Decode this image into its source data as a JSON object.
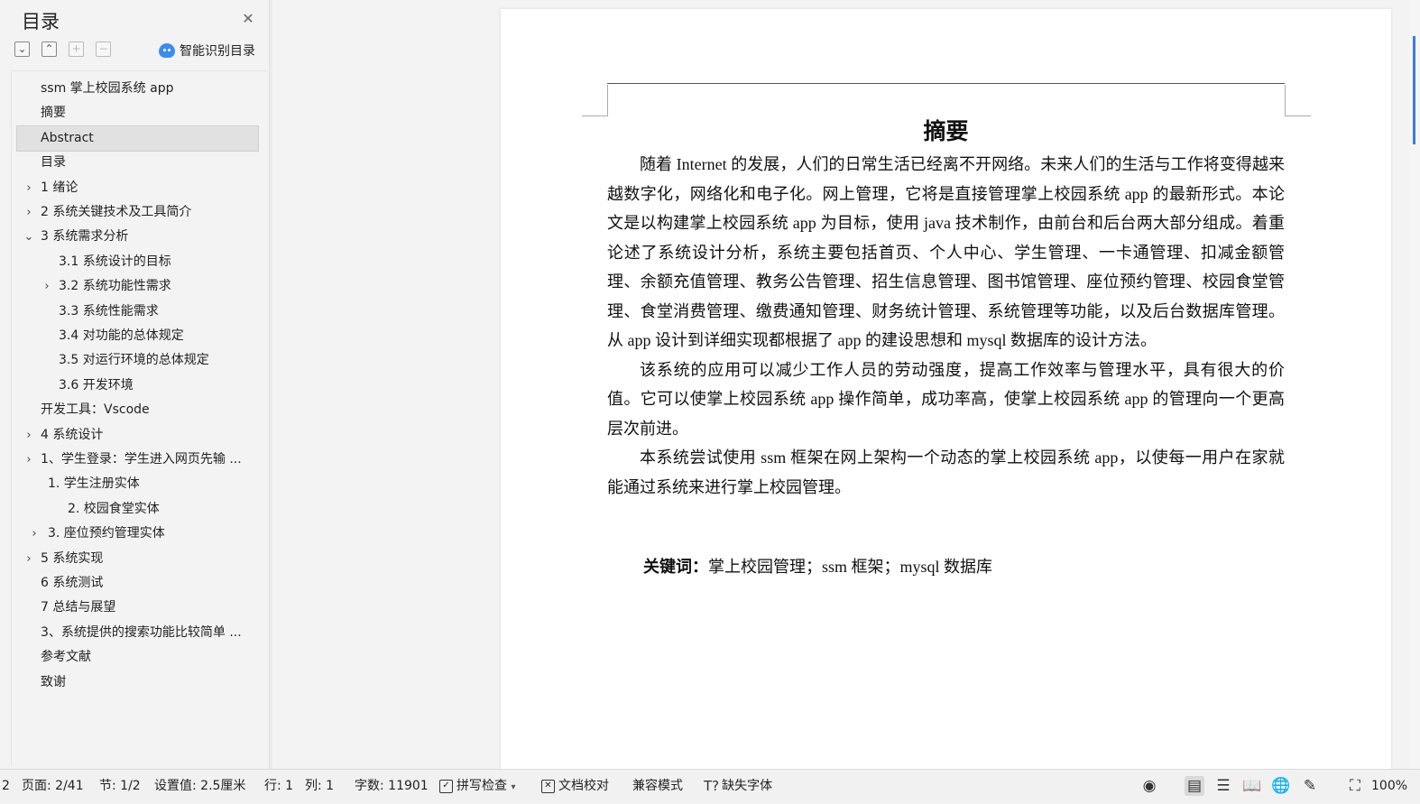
{
  "toc": {
    "title": "目录",
    "smart_button": "智能识别目录",
    "items": [
      {
        "label": "ssm 掌上校园系统 app",
        "arrow": ""
      },
      {
        "label": "摘要",
        "arrow": ""
      },
      {
        "label": "Abstract",
        "arrow": ""
      },
      {
        "label": "目录",
        "arrow": ""
      },
      {
        "label": "1 绪论",
        "arrow": "›"
      },
      {
        "label": "2 系统关键技术及工具简介",
        "arrow": "›"
      },
      {
        "label": "3 系统需求分析",
        "arrow": "⌄"
      },
      {
        "label": "3.1 系统设计的目标",
        "arrow": ""
      },
      {
        "label": "3.2 系统功能性需求",
        "arrow": "›"
      },
      {
        "label": "3.3 系统性能需求",
        "arrow": ""
      },
      {
        "label": "3.4 对功能的总体规定",
        "arrow": ""
      },
      {
        "label": "3.5 对运行环境的总体规定",
        "arrow": ""
      },
      {
        "label": "3.6 开发环境",
        "arrow": ""
      },
      {
        "label": "开发工具：Vscode",
        "arrow": ""
      },
      {
        "label": "4 系统设计",
        "arrow": "›"
      },
      {
        "label": "1、学生登录：学生进入网页先输 ...",
        "arrow": "›"
      },
      {
        "label": "1. 学生注册实体",
        "arrow": ""
      },
      {
        "label": "2. 校园食堂实体",
        "arrow": ""
      },
      {
        "label": "3. 座位预约管理实体",
        "arrow": "›"
      },
      {
        "label": "5 系统实现",
        "arrow": "›"
      },
      {
        "label": "6 系统测试",
        "arrow": ""
      },
      {
        "label": "7 总结与展望",
        "arrow": ""
      },
      {
        "label": "3、系统提供的搜索功能比较简单 ...",
        "arrow": ""
      },
      {
        "label": "参考文献",
        "arrow": ""
      },
      {
        "label": "致谢",
        "arrow": ""
      }
    ]
  },
  "document": {
    "title": "摘要",
    "paragraphs": [
      "随着 Internet 的发展，人们的日常生活已经离不开网络。未来人们的生活与工作将变得越来越数字化，网络化和电子化。网上管理，它将是直接管理掌上校园系统 app 的最新形式。本论文是以构建掌上校园系统 app 为目标，使用 java 技术制作，由前台和后台两大部分组成。着重论述了系统设计分析，系统主要包括首页、个人中心、学生管理、一卡通管理、扣减金额管理、余额充值管理、教务公告管理、招生信息管理、图书馆管理、座位预约管理、校园食堂管理、食堂消费管理、缴费通知管理、财务统计管理、系统管理等功能，以及后台数据库管理。从 app 设计到详细实现都根据了 app 的建设思想和 mysql 数据库的设计方法。",
      "该系统的应用可以减少工作人员的劳动强度，提高工作效率与管理水平，具有很大的价值。它可以使掌上校园系统 app 操作简单，成功率高，使掌上校园系统 app 的管理向一个更高层次前进。",
      "本系统尝试使用 ssm 框架在网上架构一个动态的掌上校园系统 app，以使每一用户在家就能通过系统来进行掌上校园管理。"
    ],
    "keywords_label": "关键词：",
    "keywords": "掌上校园管理；ssm 框架；mysql 数据库"
  },
  "status": {
    "first": "2",
    "page": "页面: 2/41",
    "section": "节: 1/2",
    "setting": "设置值: 2.5厘米",
    "row": "行: 1",
    "col": "列: 1",
    "wordcount": "字数: 11901",
    "spellcheck": "拼写检查",
    "proofread": "文档校对",
    "compat": "兼容模式",
    "missing_font": "缺失字体",
    "zoom": "100%"
  }
}
